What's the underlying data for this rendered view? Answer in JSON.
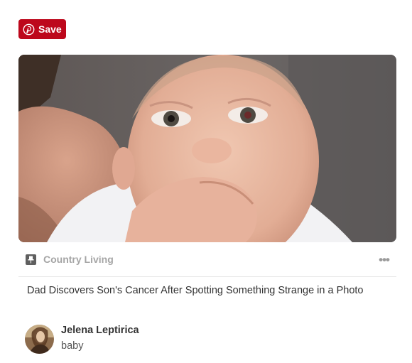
{
  "save_button": {
    "label": "Save",
    "icon": "pinterest-logo-icon",
    "color": "#bd081c"
  },
  "pin": {
    "image_alt": "baby",
    "source": {
      "icon": "pin-icon",
      "name": "Country Living"
    },
    "more_icon": "more-dots-icon",
    "more_glyph": "•••",
    "description": "Dad Discovers Son's Cancer After Spotting Something Strange in a Photo"
  },
  "pinner": {
    "name": "Jelena Leptirica",
    "board": "baby",
    "avatar_icon": "avatar"
  }
}
